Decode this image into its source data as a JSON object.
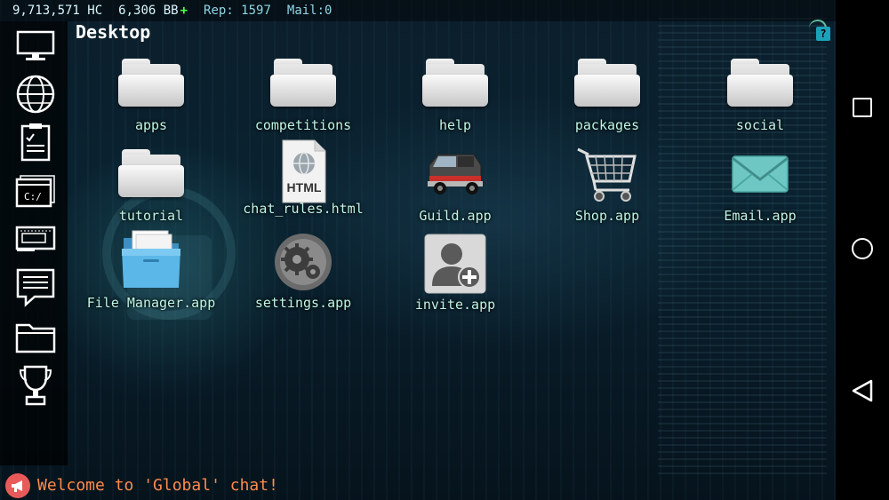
{
  "status": {
    "hc": "9,713,571 HC",
    "bb": "6,306 BB",
    "bb_plus": "+",
    "rep": "Rep: 1597",
    "mail": "Mail:0"
  },
  "window": {
    "title": "Desktop",
    "help_badge": "?"
  },
  "dock": {
    "items": [
      {
        "name": "desktop",
        "icon": "monitor-icon"
      },
      {
        "name": "browser",
        "icon": "globe-icon"
      },
      {
        "name": "tasks",
        "icon": "clipboard-icon"
      },
      {
        "name": "terminal",
        "icon": "terminal-icon",
        "text": "C:/"
      },
      {
        "name": "hardware",
        "icon": "card-icon"
      },
      {
        "name": "chat",
        "icon": "chat-icon"
      },
      {
        "name": "files",
        "icon": "folder-icon"
      },
      {
        "name": "trophy",
        "icon": "trophy-icon"
      }
    ]
  },
  "desktop": {
    "icons": [
      {
        "label": "apps",
        "icon": "folder-icon"
      },
      {
        "label": "competitions",
        "icon": "folder-icon"
      },
      {
        "label": "help",
        "icon": "folder-icon"
      },
      {
        "label": "packages",
        "icon": "folder-icon"
      },
      {
        "label": "social",
        "icon": "folder-icon"
      },
      {
        "label": "tutorial",
        "icon": "folder-icon"
      },
      {
        "label": "chat_rules.html",
        "icon": "html-file-icon",
        "badge": "HTML"
      },
      {
        "label": "Guild.app",
        "icon": "van-icon"
      },
      {
        "label": "Shop.app",
        "icon": "cart-icon"
      },
      {
        "label": "Email.app",
        "icon": "envelope-icon"
      },
      {
        "label": "File Manager.app",
        "icon": "file-manager-icon"
      },
      {
        "label": "settings.app",
        "icon": "gear-icon"
      },
      {
        "label": "invite.app",
        "icon": "add-user-icon"
      }
    ]
  },
  "chat": {
    "message": "Welcome to 'Global' chat!",
    "icon": "megaphone-icon"
  },
  "colors": {
    "label": "#bff6e6",
    "chat": "#ff8a4c",
    "accent": "#1aa3b8",
    "bb_plus": "#4cff4c"
  }
}
